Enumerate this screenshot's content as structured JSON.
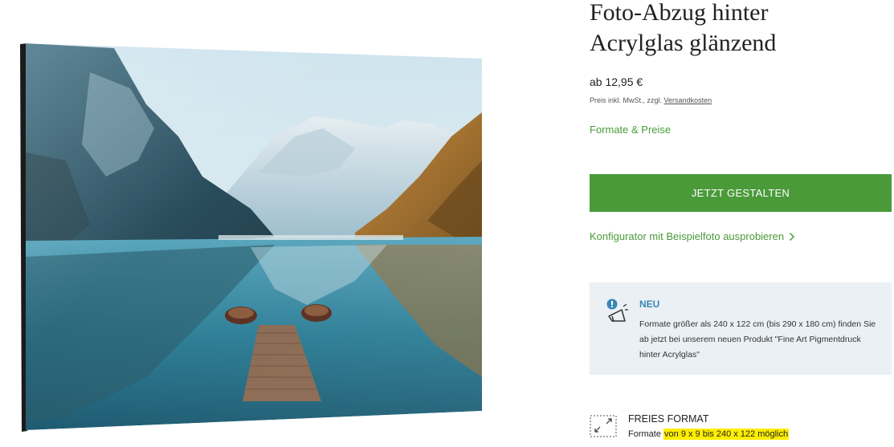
{
  "product": {
    "image_alt": "Acrylglas mit Bergsee und Booten"
  },
  "info": {
    "title_line1": "Foto-Abzug hinter",
    "title_line2": "Acrylglas glänzend",
    "price": "ab 12,95 €",
    "tax_note_prefix": "Preis inkl. MwSt., zzgl.",
    "tax_note_link": "Versandkosten",
    "formats_link": "Formate & Preise",
    "cta_label": "JETZT GESTALTEN",
    "config_link": "Konfigurator mit Beispielfoto ausprobieren",
    "config_icon": "chevron-right-icon"
  },
  "notice": {
    "icon": "megaphone-icon",
    "title": "NEU",
    "text": "Formate größer als 240 x 122 cm (bis 290 x 180 cm) finden Sie ab jetzt bei unserem neuen Produkt \"Fine Art Pigmentdruck hinter Acrylglas\""
  },
  "free_format": {
    "icon": "resize-arrows-icon",
    "title": "FREIES FORMAT",
    "text_prefix": "Formate",
    "text_highlight": "von 9 x 9 bis 240 x 122 möglich"
  },
  "colors": {
    "accent_green": "#4a9a3a",
    "notice_bg": "#eaf0f4",
    "notice_title": "#3c86b6",
    "highlight": "#ffee00"
  }
}
